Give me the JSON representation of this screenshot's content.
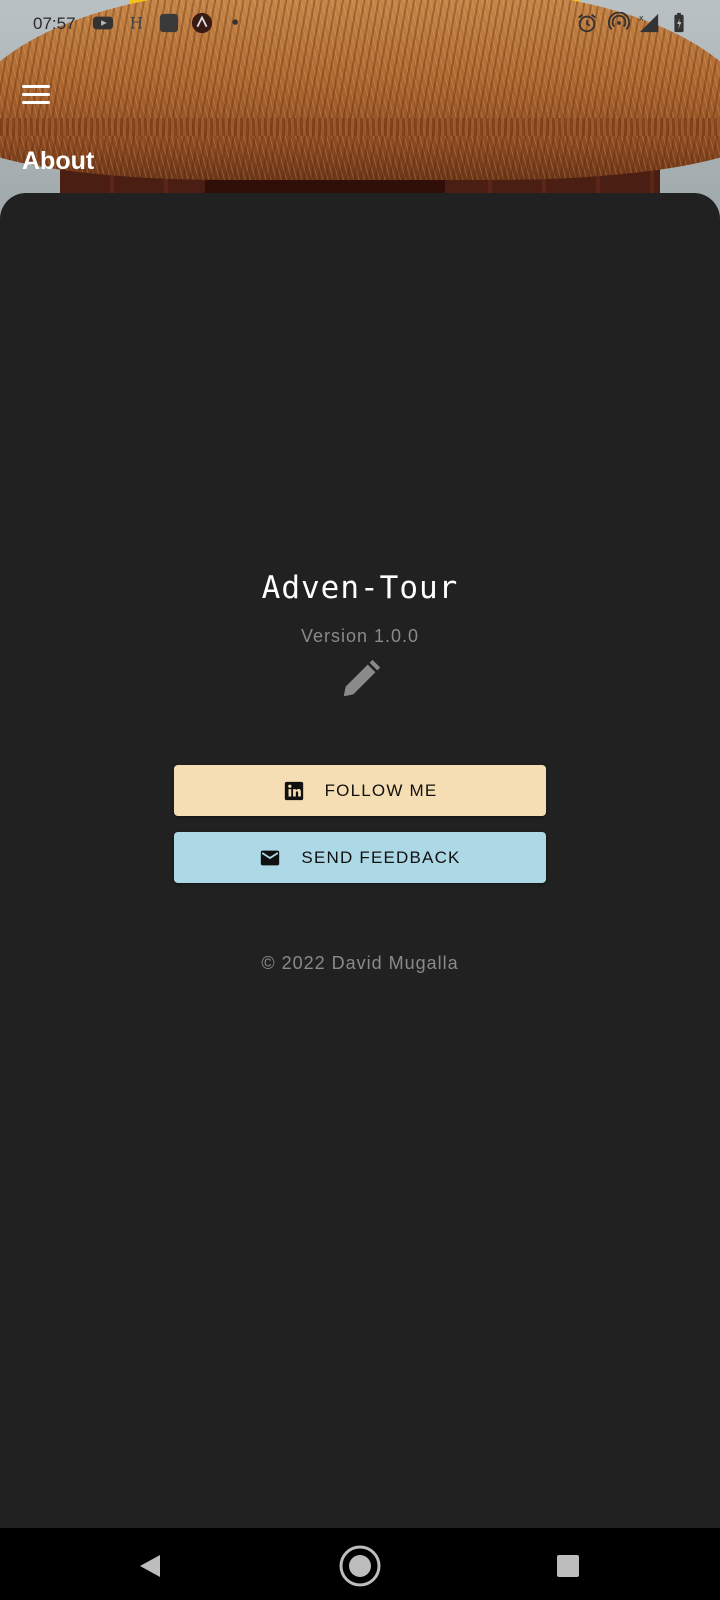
{
  "status_bar": {
    "time": "07:57",
    "left_icons": [
      "youtube-icon",
      "h-icon",
      "app-icon",
      "arc-icon",
      "dot-icon"
    ],
    "right_icons": [
      "alarm-icon",
      "hotspot-icon",
      "signal-icon",
      "battery-icon"
    ]
  },
  "app_bar": {
    "title": "About",
    "menu_icon": "hamburger-menu-icon"
  },
  "about": {
    "app_name": "Adven-Tour",
    "version": "Version 1.0.0",
    "edit_icon": "pencil-icon"
  },
  "buttons": {
    "follow_label": "FOLLOW ME",
    "follow_icon": "linkedin-icon",
    "feedback_label": "SEND FEEDBACK",
    "feedback_icon": "mail-icon"
  },
  "footer": {
    "copyright": "© 2022 David Mugalla"
  },
  "colors": {
    "background": "#212121",
    "follow_button": "#f5deb3",
    "feedback_button": "#add8e6",
    "muted_text": "#8a8a8a"
  },
  "nav_bar": {
    "icons": [
      "back-icon",
      "home-icon",
      "recents-icon"
    ]
  }
}
